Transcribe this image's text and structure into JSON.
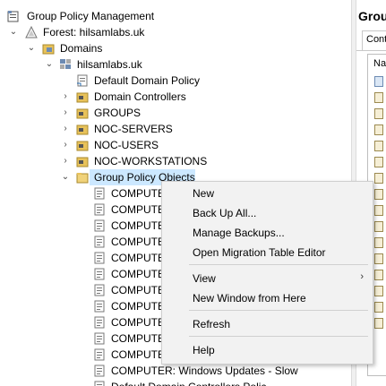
{
  "tree": {
    "root": "Group Policy Management",
    "forest": "Forest: hilsamlabs.uk",
    "domains": "Domains",
    "domain": "hilsamlabs.uk",
    "children": [
      "Default Domain Policy",
      "Domain Controllers",
      "GROUPS",
      "NOC-SERVERS",
      "NOC-USERS",
      "NOC-WORKSTATIONS",
      "Group Policy Objects"
    ],
    "gpos": [
      "COMPUTE",
      "COMPUTE",
      "COMPUTE",
      "COMPUTE",
      "COMPUTE",
      "COMPUTE",
      "COMPUTE",
      "COMPUTE",
      "COMPUTE",
      "COMPUTE",
      "COMPUTE",
      "COMPUTER: Windows Updates - Slow",
      "Default Domain Controllers Polic"
    ]
  },
  "right_pane": {
    "title": "Grou",
    "tab": "Cont",
    "column": "Na"
  },
  "context_menu": {
    "items": [
      "New",
      "Back Up All...",
      "Manage Backups...",
      "Open Migration Table Editor",
      "View",
      "New Window from Here",
      "Refresh",
      "Help"
    ],
    "submenu_arrow": "›"
  },
  "colors": {
    "selection": "#cce8ff",
    "menu_bg": "#f2f2f2",
    "folder": "#e8c25a"
  }
}
